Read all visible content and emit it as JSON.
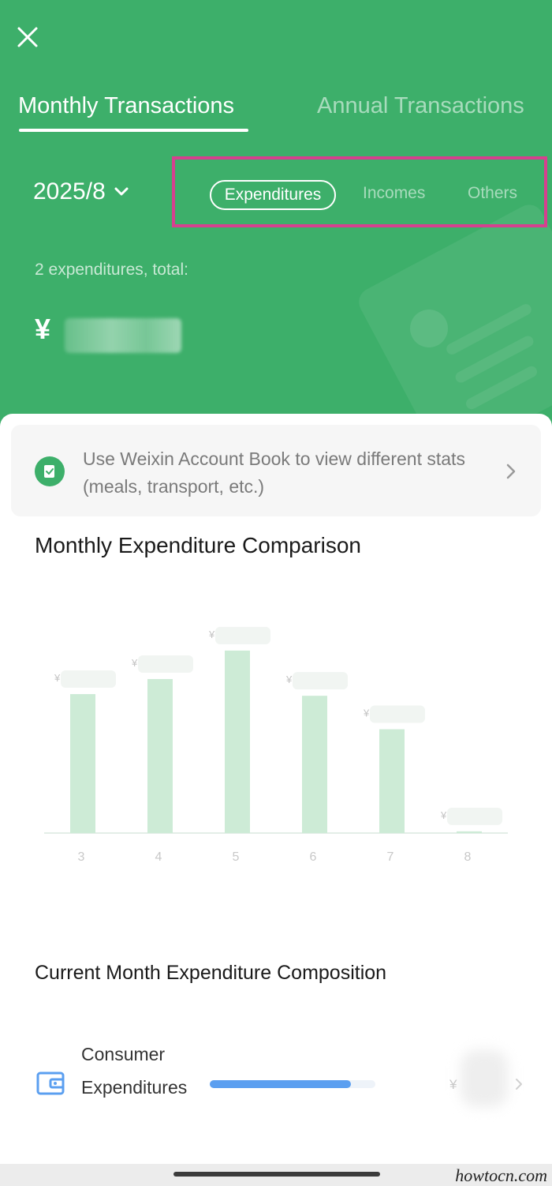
{
  "header": {
    "close_icon": "close-icon",
    "tabs": [
      {
        "label": "Monthly Transactions",
        "active": true
      },
      {
        "label": "Annual Transactions",
        "active": false
      }
    ],
    "date_selector": "2025/8",
    "type_filters": [
      {
        "label": "Expenditures",
        "active": true
      },
      {
        "label": "Incomes",
        "active": false
      },
      {
        "label": "Others",
        "active": false
      }
    ],
    "count_text": "2 expenditures, total:",
    "currency_symbol": "¥",
    "highlight_color": "#d6408f",
    "header_color": "#3daf6a"
  },
  "banner": {
    "text": "Use Weixin Account Book to view different stats (meals, transport, etc.)",
    "icon": "account-book-icon"
  },
  "comparison": {
    "title": "Monthly Expenditure Comparison"
  },
  "chart_data": {
    "type": "bar",
    "categories": [
      "3",
      "4",
      "5",
      "6",
      "7",
      "8"
    ],
    "values": [
      166,
      184,
      218,
      164,
      124,
      2
    ],
    "value_labels_hidden": true,
    "value_prefix": "¥",
    "title": "",
    "xlabel": "",
    "ylabel": "",
    "ylim": [
      0,
      250
    ],
    "grid": false,
    "bar_color": "#cdebd6"
  },
  "composition": {
    "title": "Current Month Expenditure Composition",
    "items": [
      {
        "label": "Consumer Expenditures",
        "currency_symbol": "¥",
        "share": 0.85,
        "color": "#5b9ff0",
        "icon": "wallet-icon"
      }
    ]
  },
  "watermark": "howtocn.com"
}
